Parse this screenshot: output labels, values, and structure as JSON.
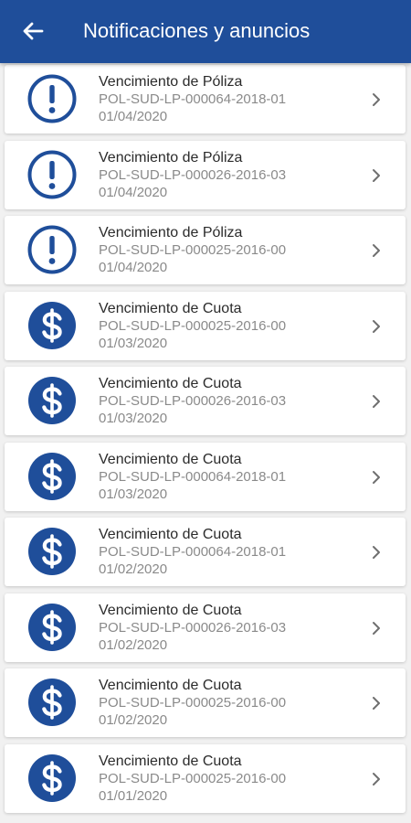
{
  "header": {
    "title": "Notificaciones y anuncios",
    "back_icon": "arrow-left-icon"
  },
  "colors": {
    "appbar": "#1f4e9a",
    "icon": "#1f4e9a"
  },
  "notifications": [
    {
      "type": "warning",
      "icon": "exclamation-circle-icon",
      "title": "Vencimiento de Póliza",
      "policy": "POL-SUD-LP-000064-2018-01",
      "date": "01/04/2020"
    },
    {
      "type": "warning",
      "icon": "exclamation-circle-icon",
      "title": "Vencimiento de Póliza",
      "policy": "POL-SUD-LP-000026-2016-03",
      "date": "01/04/2020"
    },
    {
      "type": "warning",
      "icon": "exclamation-circle-icon",
      "title": "Vencimiento de Póliza",
      "policy": "POL-SUD-LP-000025-2016-00",
      "date": "01/04/2020"
    },
    {
      "type": "payment",
      "icon": "dollar-circle-icon",
      "title": "Vencimiento de Cuota",
      "policy": "POL-SUD-LP-000025-2016-00",
      "date": "01/03/2020"
    },
    {
      "type": "payment",
      "icon": "dollar-circle-icon",
      "title": "Vencimiento de Cuota",
      "policy": "POL-SUD-LP-000026-2016-03",
      "date": "01/03/2020"
    },
    {
      "type": "payment",
      "icon": "dollar-circle-icon",
      "title": "Vencimiento de Cuota",
      "policy": "POL-SUD-LP-000064-2018-01",
      "date": "01/03/2020"
    },
    {
      "type": "payment",
      "icon": "dollar-circle-icon",
      "title": "Vencimiento de Cuota",
      "policy": "POL-SUD-LP-000064-2018-01",
      "date": "01/02/2020"
    },
    {
      "type": "payment",
      "icon": "dollar-circle-icon",
      "title": "Vencimiento de Cuota",
      "policy": "POL-SUD-LP-000026-2016-03",
      "date": "01/02/2020"
    },
    {
      "type": "payment",
      "icon": "dollar-circle-icon",
      "title": "Vencimiento de Cuota",
      "policy": "POL-SUD-LP-000025-2016-00",
      "date": "01/02/2020"
    },
    {
      "type": "payment",
      "icon": "dollar-circle-icon",
      "title": "Vencimiento de Cuota",
      "policy": "POL-SUD-LP-000025-2016-00",
      "date": "01/01/2020"
    }
  ]
}
